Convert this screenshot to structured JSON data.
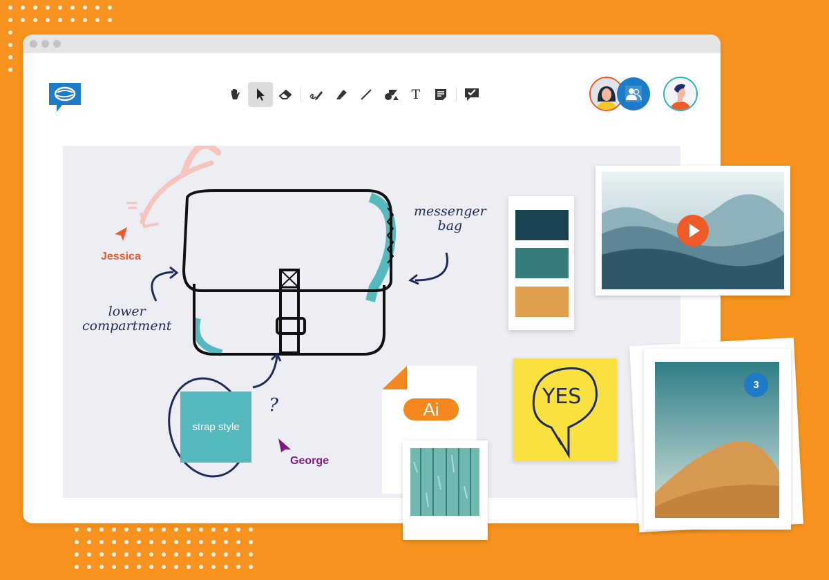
{
  "toolbar": {
    "tools": [
      {
        "name": "hand-icon",
        "label": "Pan"
      },
      {
        "name": "pointer-icon",
        "label": "Select",
        "active": true
      },
      {
        "name": "eraser-icon",
        "label": "Eraser"
      },
      {
        "name": "pen-icon",
        "label": "Pen"
      },
      {
        "name": "highlighter-icon",
        "label": "Highlighter"
      },
      {
        "name": "line-icon",
        "label": "Line"
      },
      {
        "name": "shapes-icon",
        "label": "Shapes"
      },
      {
        "name": "text-icon",
        "label": "T"
      },
      {
        "name": "sticky-note-icon",
        "label": "Note"
      },
      {
        "name": "comment-check-icon",
        "label": "Feedback"
      }
    ]
  },
  "collaborators": [
    {
      "name": "Jessica",
      "ring": "#f05a28"
    },
    {
      "name": "group",
      "ring": "#1e7bc8"
    },
    {
      "name": "George",
      "ring": "#2bb5b5"
    }
  ],
  "board": {
    "note_messenger": "messenger\nbag",
    "note_lower": "lower\ncompartment",
    "question": "?",
    "strap_label": "strap style",
    "cursor_jessica": "Jessica",
    "cursor_george": "George",
    "file_type": "Ai",
    "sticky_text": "YES",
    "photo_count": "3"
  },
  "colors": {
    "background": "#f7931e",
    "brand": "#1e7bc8",
    "jessica": "#f05a28",
    "george": "#7b1c7f",
    "palette": [
      "#1b4250",
      "#357c7b",
      "#e0a050"
    ],
    "sticky": "#f9e13f",
    "strap": "#56b9bd"
  }
}
